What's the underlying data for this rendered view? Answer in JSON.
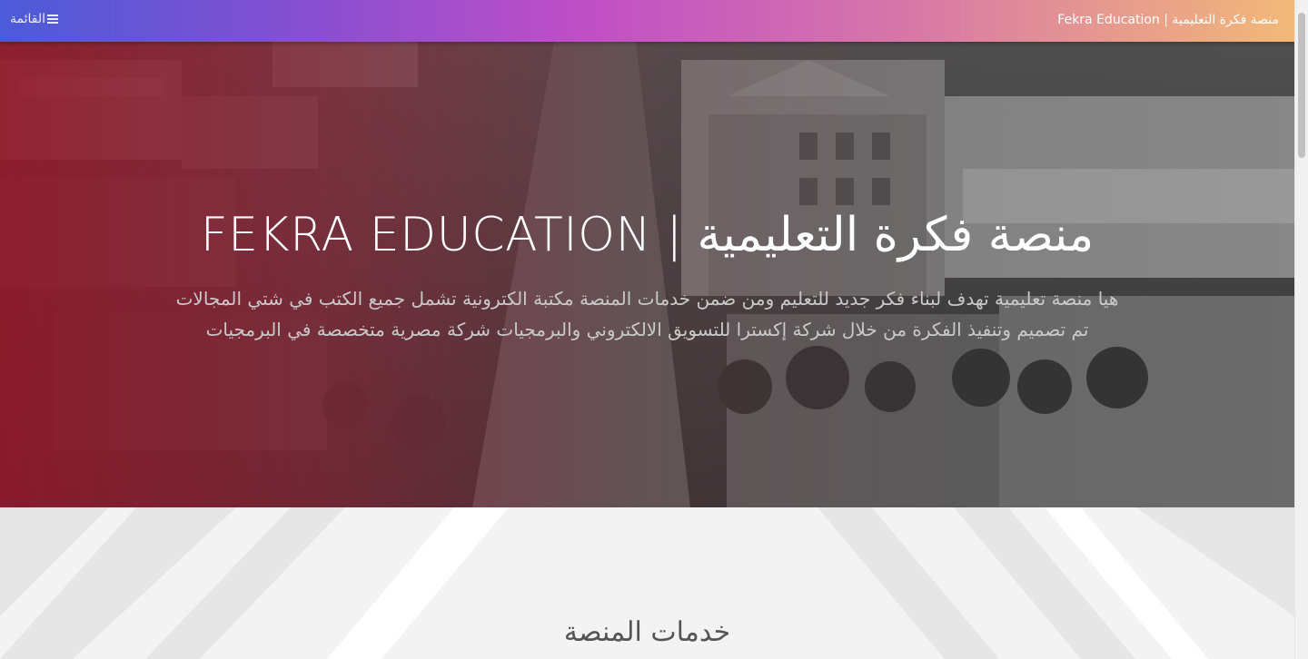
{
  "navbar": {
    "brand": "منصة فكرة التعليمية | Fekra Education",
    "menu_label": "القائمة",
    "menu_icon": "bars-icon"
  },
  "hero": {
    "title": "منصة فكرة التعليمية | FEKRA EDUCATION",
    "description_line1": "هيا منصة تعليمية تهدف لبناء فكر جديد للتعليم ومن ضمن خدمات المنصة مكتبة الكترونية تشمل جميع الكتب في شتي المجالات",
    "description_line2": "تم تصميم وتنفيذ الفكرة من خلال شركة إكسترا للتسويق الالكتروني والبرمجيات شركة مصرية متخصصة في البرمجيات"
  },
  "services": {
    "title": "خدمات المنصة"
  },
  "colors": {
    "navbar_start": "#4c5bd8",
    "navbar_mid": "#c04fc6",
    "navbar_end": "#f2b978",
    "hero_overlay": "#96142b"
  }
}
